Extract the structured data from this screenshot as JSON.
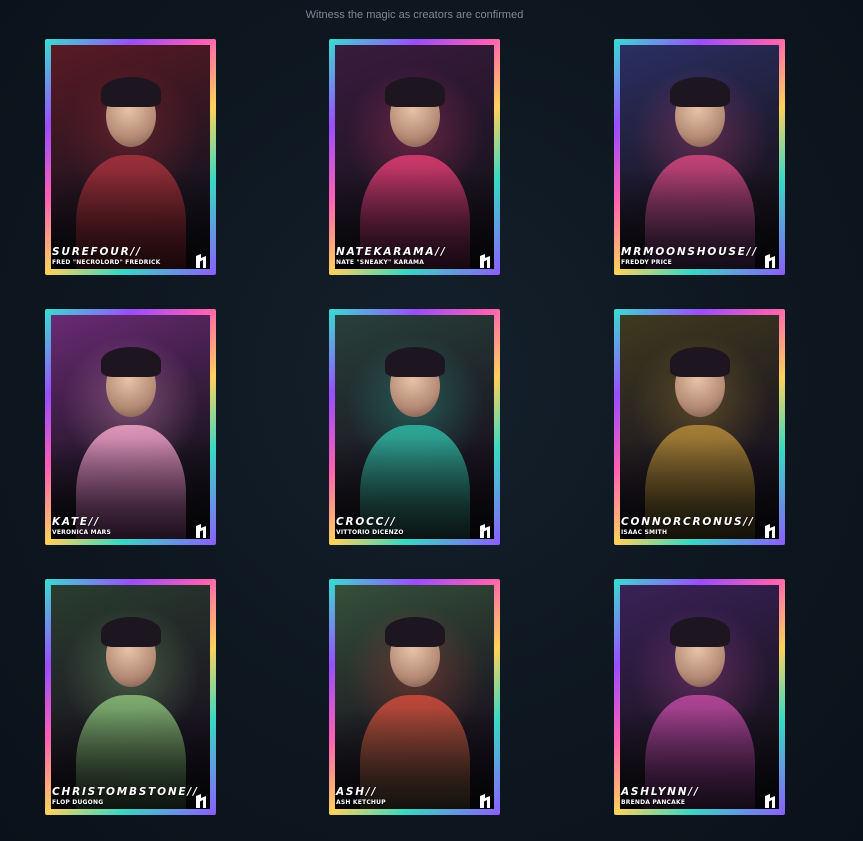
{
  "subtitle": "Witness the magic as creators are confirmed",
  "brand_icon": "creator-logo-icon",
  "cards": [
    {
      "name": "SUREFOUR//",
      "real_name": "FRED \"NECROLORD\" FREDRICK",
      "portrait": "masked-figure-portrait",
      "bg": "#5a1a24",
      "accent": "#a8323c"
    },
    {
      "name": "NATEKARAMA//",
      "real_name": "NATE \"SNEAKY\" KARAMA",
      "portrait": "skeleton-magician-portrait",
      "bg": "#3a1b3e",
      "accent": "#e23d72"
    },
    {
      "name": "MRMOONSHOUSE//",
      "real_name": "FREDDY PRICE",
      "portrait": "police-officer-portrait",
      "bg": "#2a2f62",
      "accent": "#d8467c"
    },
    {
      "name": "KATE//",
      "real_name": "VERONICA MARS",
      "portrait": "woman-pink-jacket-portrait",
      "bg": "#6a2a74",
      "accent": "#f2a6c8"
    },
    {
      "name": "CROCC//",
      "real_name": "VITTORIO DICENZO",
      "portrait": "man-teal-shirt-portrait",
      "bg": "#28403a",
      "accent": "#2fb9a6"
    },
    {
      "name": "CONNORCRONUS//",
      "real_name": "ISAAC SMITH",
      "portrait": "old-man-coat-portrait",
      "bg": "#3e3a1e",
      "accent": "#b58a3a"
    },
    {
      "name": "CHRISTOMBSTONE//",
      "real_name": "FLOP DUGONG",
      "portrait": "biker-cap-portrait",
      "bg": "#2a3d30",
      "accent": "#8bbf7a"
    },
    {
      "name": "ASH//",
      "real_name": "ASH KETCHUP",
      "portrait": "red-hair-bandana-portrait",
      "bg": "#35503a",
      "accent": "#d24a3a"
    },
    {
      "name": "ASHLYNN//",
      "real_name": "BRENDA PANCAKE",
      "portrait": "police-woman-portrait",
      "bg": "#3a2158",
      "accent": "#c04aa0"
    }
  ]
}
